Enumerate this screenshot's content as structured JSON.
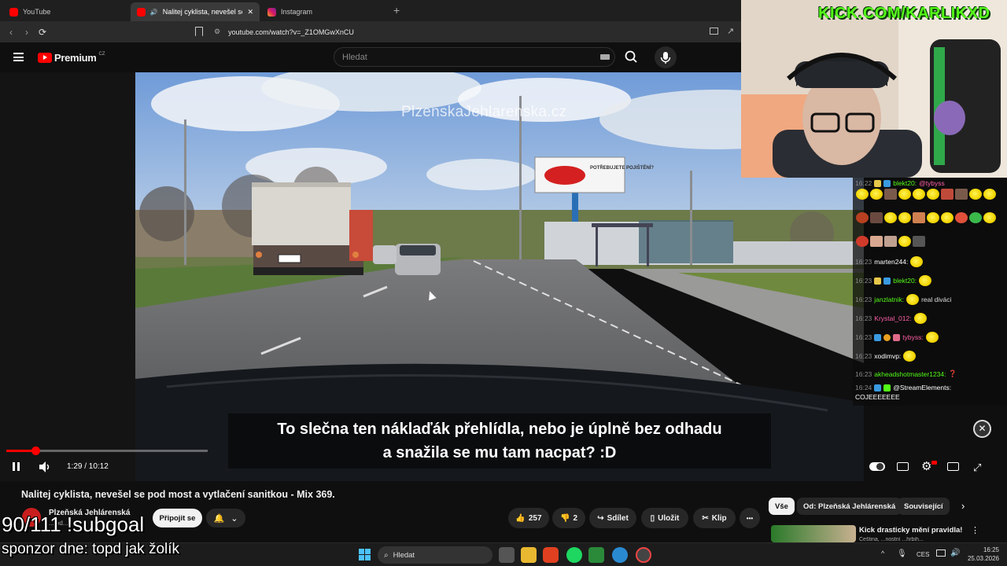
{
  "browser": {
    "tabs": [
      {
        "label": "YouTube",
        "active": false
      },
      {
        "label": "Nalitej cyklista, nevešel se pod",
        "active": true
      },
      {
        "label": "Instagram",
        "active": false
      }
    ],
    "new_tab": "+",
    "close_glyph": "✕",
    "url": "youtube.com/watch?v=_Z1OMGwXnCU"
  },
  "youtube": {
    "logo_text": "Premium",
    "logo_region": "CZ",
    "search_placeholder": "Hledat",
    "watermark": "PlzenskaJehlarenska.cz",
    "billboard_text": "POTŘEBUJETE POJIŠTĚNÍ?",
    "caption_line1": "To slečna ten náklaďák přehlídla, nebo je úplně bez odhadu",
    "caption_line2": "a snažila se mu tam nacpat? :D",
    "time": "1:29 / 10:12",
    "progress_fraction": 0.1456,
    "video_title": "Nalitej cyklista, nevešel se pod most a vytlačení sanitkou - Mix 369.",
    "channel_name": "Plzeňská Jehlárenská",
    "channel_sub": "... od...",
    "subscribe_label": "Připojit se",
    "likes": "257",
    "dislikes": "2",
    "share_label": "Sdílet",
    "save_label": "Uložit",
    "clip_label": "Klip",
    "more_label": "•••",
    "chips": [
      "Vše",
      "Od: Plzeňská Jehlárenská",
      "Související"
    ],
    "rec_title": "Kick drasticky mění pravidla!",
    "rec_sub": "Čeština, ...nostní ...hrbih..."
  },
  "stream": {
    "kick_url": "KICK.COM/KARLIKXD",
    "subgoal": "90/111 !subgoal",
    "sponzor": "sponzor dne: topd jak žolík",
    "chat": [
      {
        "time": "16:22",
        "user": "blekt20:",
        "user_color": "#53fc18",
        "text": "@tybyss"
      },
      {
        "time": "16:23",
        "user": "marten244:",
        "user_color": "#ffffff",
        "text": ""
      },
      {
        "time": "16:23",
        "user": "blekt20:",
        "user_color": "#53fc18",
        "text": ""
      },
      {
        "time": "16:23",
        "user": "janzlatnik:",
        "user_color": "#53fc18",
        "text": "real diváci"
      },
      {
        "time": "16:23",
        "user": "Krystal_012:",
        "user_color": "#ff5fa8",
        "text": ""
      },
      {
        "time": "16:23",
        "user": "tybyss:",
        "user_color": "#ff5fa8",
        "text": ""
      },
      {
        "time": "16:23",
        "user": "xodimvp:",
        "user_color": "#ffffff",
        "text": ""
      },
      {
        "time": "16:23",
        "user": "akheadshotmaster1234:",
        "user_color": "#53fc18",
        "text": "❓"
      },
      {
        "time": "16:24",
        "user": "@StreamElements:",
        "user_color": "#ffffff",
        "text": "COJEEEEEEE"
      }
    ]
  },
  "taskbar": {
    "search_placeholder": "Hledat",
    "lang": "CES",
    "time": "16:25",
    "date": "25.03.2026"
  }
}
